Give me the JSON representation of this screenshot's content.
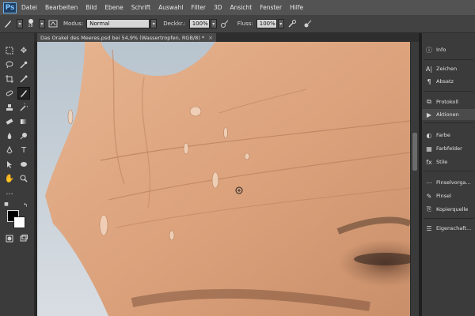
{
  "app": {
    "logo": "Ps"
  },
  "menu": [
    "Datei",
    "Bearbeiten",
    "Bild",
    "Ebene",
    "Schrift",
    "Auswahl",
    "Filter",
    "3D",
    "Ansicht",
    "Fenster",
    "Hilfe"
  ],
  "options": {
    "brush_size": "18",
    "mode_label": "Modus:",
    "mode_value": "Normal",
    "opacity_label": "Deckkr.:",
    "opacity_value": "100%",
    "flow_label": "Fluss:",
    "flow_value": "100%"
  },
  "document": {
    "tab_title": "Das Orakel des Meeres.psd bei 54,9% (Wassertropfen, RGB/8) *",
    "close": "×"
  },
  "colors": {
    "foreground": "#000000",
    "background": "#ffffff"
  },
  "panels": [
    {
      "label": "Info",
      "icon": "info-icon"
    },
    {
      "label": "Zeichen",
      "icon": "character-icon"
    },
    {
      "label": "Absatz",
      "icon": "paragraph-icon"
    },
    {
      "label": "Protokoll",
      "icon": "history-icon"
    },
    {
      "label": "Aktionen",
      "icon": "actions-icon"
    },
    {
      "label": "Farbe",
      "icon": "color-icon"
    },
    {
      "label": "Farbfelder",
      "icon": "swatches-icon"
    },
    {
      "label": "Stile",
      "icon": "styles-icon"
    },
    {
      "label": "Pinselvorga...",
      "icon": "brush-presets-icon"
    },
    {
      "label": "Pinsel",
      "icon": "brush-icon"
    },
    {
      "label": "Kopierquelle",
      "icon": "clone-source-icon"
    },
    {
      "label": "Eigenschaft...",
      "icon": "properties-icon"
    }
  ]
}
